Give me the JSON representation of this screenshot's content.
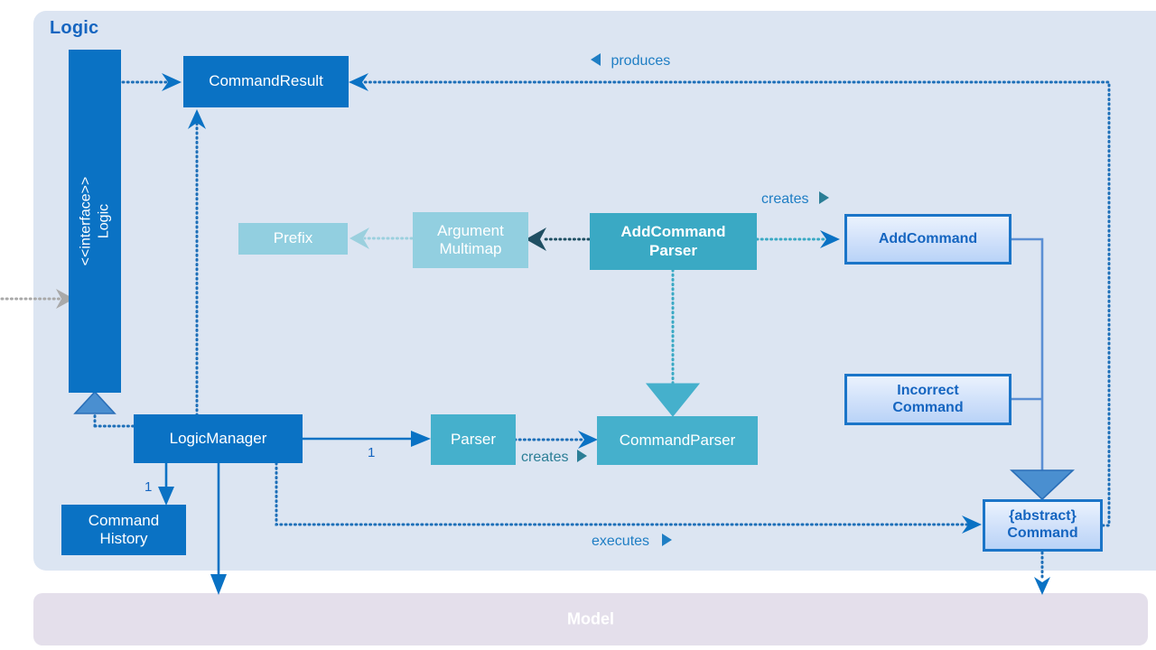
{
  "diagram": {
    "title": "Logic",
    "external_panel": {
      "label": "Model"
    }
  },
  "nodes": {
    "logic_interface": {
      "stereotype": "<<interface>>",
      "name": "Logic"
    },
    "command_result": {
      "label": "CommandResult"
    },
    "logic_manager": {
      "label": "LogicManager"
    },
    "command_history": {
      "line1": "Command",
      "line2": "History"
    },
    "parser": {
      "label": "Parser"
    },
    "command_parser": {
      "label": "CommandParser"
    },
    "add_command_parser": {
      "line1": "AddCommand",
      "line2": "Parser"
    },
    "argument_multimap": {
      "line1": "Argument",
      "line2": "Multimap"
    },
    "prefix": {
      "label": "Prefix"
    },
    "add_command": {
      "label": "AddCommand"
    },
    "incorrect_command": {
      "line1": "Incorrect",
      "line2": "Command"
    },
    "abstract_command": {
      "line1": "{abstract}",
      "line2": "Command"
    }
  },
  "edges": {
    "produces": {
      "label": "produces"
    },
    "creates_add_command": {
      "label": "creates"
    },
    "creates_command_parser": {
      "label": "creates"
    },
    "executes": {
      "label": "executes"
    }
  },
  "multiplicities": {
    "logic_manager_to_parser": "1",
    "logic_manager_to_history": "1"
  },
  "colors": {
    "panel_background": "#dce5f2",
    "model_panel_background": "#e4dfeb",
    "dark_blue": "#0a72c4",
    "teal": "#45b0cc",
    "teal_dark": "#3aa9c4",
    "teal_light": "#92cfe0",
    "command_border": "#1b75c8",
    "accent_text": "#1565c0"
  }
}
